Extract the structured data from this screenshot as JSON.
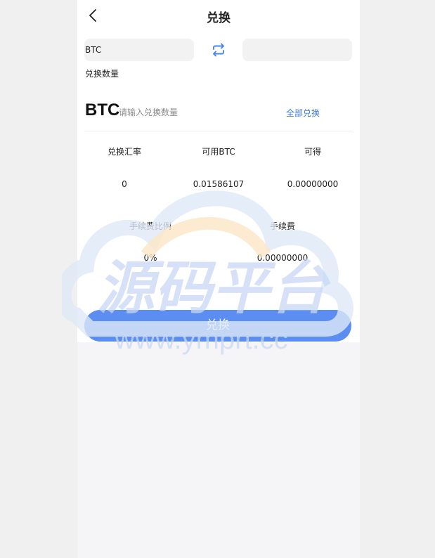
{
  "header": {
    "title": "兑换"
  },
  "exchange": {
    "from_coin": "BTC",
    "to_coin": "",
    "amount_label": "兑换数量",
    "amount_coin": "BTC",
    "amount_placeholder": "请输入兑换数量",
    "all_label": "全部兑换"
  },
  "stats": {
    "row1": [
      {
        "label": "兑换汇率",
        "value": "0"
      },
      {
        "label": "可用BTC",
        "value": "0.01586107"
      },
      {
        "label": "可得",
        "value": "0.00000000"
      }
    ],
    "row2": [
      {
        "label": "手续费比例",
        "value": "0%"
      },
      {
        "label": "手续费",
        "value": "0.00000000"
      }
    ]
  },
  "action": {
    "submit_label": "兑换"
  },
  "watermark": {
    "title": "源码平台",
    "url": "www.ymprt.cc"
  },
  "colors": {
    "accent": "#5b8ef0",
    "link": "#3d7be0",
    "swap_icon": "#4a86e8"
  }
}
